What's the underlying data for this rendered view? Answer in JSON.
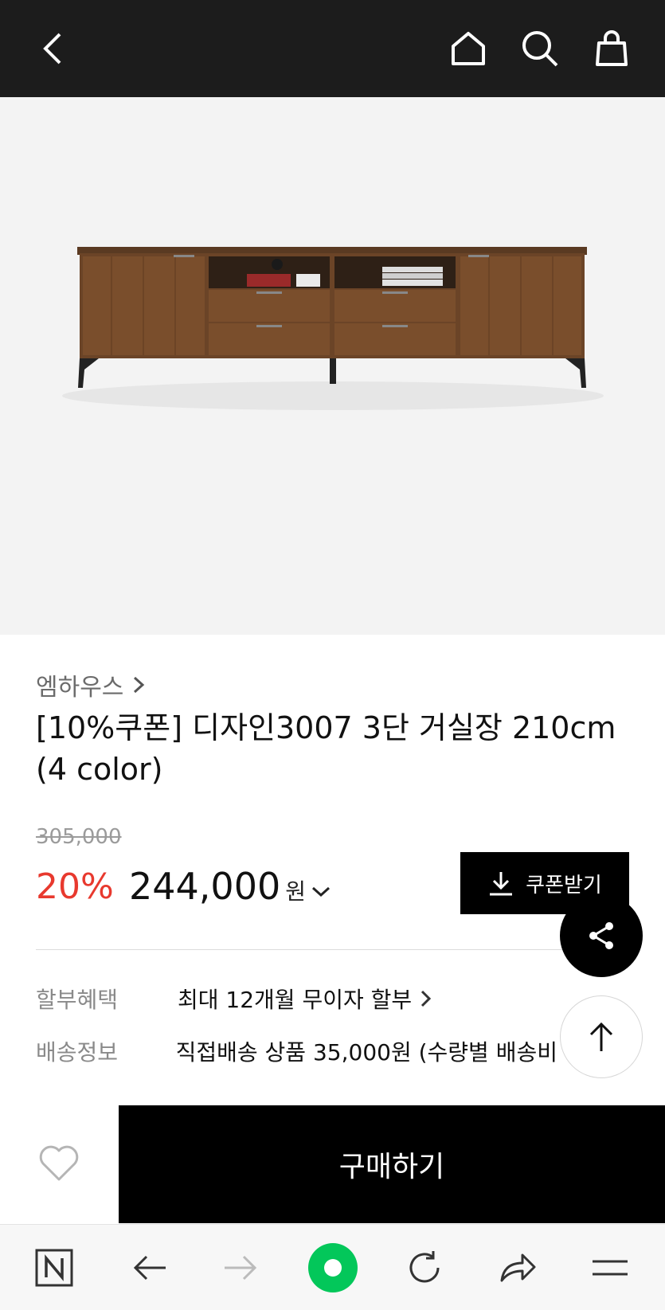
{
  "topbar": {
    "back_icon": "chevron-left-icon",
    "home_icon": "home-icon",
    "search_icon": "search-icon",
    "cart_icon": "shopping-bag-icon",
    "background": "#1c1c1c"
  },
  "product": {
    "brand": "엠하우스",
    "title": "[10%쿠폰] 디자인3007 3단 거실장 210cm (4 color)",
    "original_price": "305,000",
    "discount": "20%",
    "price": "244,000",
    "currency": "원",
    "coupon_button": "쿠폰받기"
  },
  "info": {
    "installment_label": "할부혜택",
    "installment_value": "최대 12개월 무이자 할부",
    "delivery_label": "배송정보",
    "delivery_value": "직접배송 상품 35,000원 (수량별 배송비"
  },
  "actions": {
    "buy_label": "구매하기",
    "wishlist_icon": "heart-icon",
    "share_icon": "share-icon",
    "scroll_top_icon": "arrow-up-icon"
  },
  "browser": {
    "naver_icon": "naver-n-icon",
    "back_icon": "arrow-left-icon",
    "forward_icon": "arrow-right-icon",
    "green_icon": "green-circle-icon",
    "refresh_icon": "refresh-icon",
    "share_icon": "forward-share-icon",
    "menu_icon": "menu-icon"
  },
  "colors": {
    "discount": "#e8392e",
    "accent_green": "#03c75a",
    "dark": "#000000"
  }
}
